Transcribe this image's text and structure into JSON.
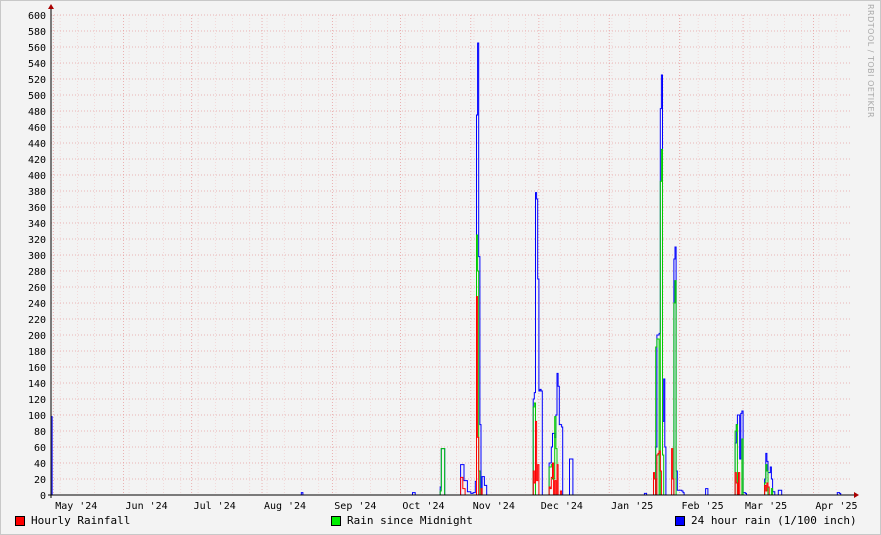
{
  "watermark": "RRDTOOL / TOBI OETIKER",
  "chart_data": {
    "type": "line",
    "ylim": [
      0,
      600
    ],
    "yticks": [
      0,
      20,
      40,
      60,
      80,
      100,
      120,
      140,
      160,
      180,
      200,
      220,
      240,
      260,
      280,
      300,
      320,
      340,
      360,
      380,
      400,
      420,
      440,
      460,
      480,
      500,
      520,
      540,
      560,
      580,
      600
    ],
    "x_tick_labels": [
      "May '24",
      "Jun '24",
      "Jul '24",
      "Aug '24",
      "Sep '24",
      "Oct '24",
      "Nov '24",
      "Dec '24",
      "Jan '25",
      "Feb '25",
      "Mar '25",
      "Apr '25"
    ],
    "x_tick_days": [
      0,
      31,
      61,
      92,
      123,
      153,
      184,
      214,
      245,
      276,
      304,
      335
    ],
    "xlim_days": [
      -1,
      352
    ],
    "grid": true,
    "legend_position": "bottom",
    "colors": {
      "hourly": "#ff0000",
      "midnight": "#00cc00",
      "day24": "#0000ff",
      "axis": "#aa0000",
      "grid": "#e8a0a0"
    },
    "series": [
      {
        "key": "day24",
        "name": "24 hour rain (1/100 inch)",
        "points": [
          [
            -1,
            98
          ],
          [
            -0.5,
            0
          ],
          [
            109,
            0
          ],
          [
            109.3,
            3
          ],
          [
            110,
            0
          ],
          [
            158,
            0
          ],
          [
            158.3,
            3
          ],
          [
            159.5,
            0
          ],
          [
            170,
            0
          ],
          [
            170.5,
            10
          ],
          [
            171,
            58
          ],
          [
            172.5,
            0
          ],
          [
            179,
            0
          ],
          [
            179.5,
            38
          ],
          [
            181,
            18
          ],
          [
            182.5,
            4
          ],
          [
            184,
            2
          ],
          [
            185,
            3
          ],
          [
            186,
            17
          ],
          [
            186.5,
            475
          ],
          [
            187,
            565
          ],
          [
            187.5,
            298
          ],
          [
            188,
            88
          ],
          [
            188.5,
            2
          ],
          [
            189,
            23
          ],
          [
            190,
            12
          ],
          [
            191,
            0
          ],
          [
            211,
            0
          ],
          [
            211.5,
            120
          ],
          [
            212,
            128
          ],
          [
            212.5,
            378
          ],
          [
            213,
            370
          ],
          [
            213.5,
            270
          ],
          [
            214,
            130
          ],
          [
            214.5,
            132
          ],
          [
            215,
            130
          ],
          [
            215.5,
            0
          ],
          [
            218,
            0
          ],
          [
            218.5,
            40
          ],
          [
            219.5,
            60
          ],
          [
            220,
            77
          ],
          [
            221,
            72
          ],
          [
            221.5,
            100
          ],
          [
            222,
            152
          ],
          [
            222.5,
            136
          ],
          [
            223,
            88
          ],
          [
            224,
            85
          ],
          [
            224.5,
            0
          ],
          [
            227,
            0
          ],
          [
            227.5,
            45
          ],
          [
            229,
            0
          ],
          [
            260,
            0
          ],
          [
            260.5,
            2
          ],
          [
            261.5,
            0
          ],
          [
            265,
            0
          ],
          [
            265.5,
            60
          ],
          [
            266,
            200
          ],
          [
            267,
            202
          ],
          [
            267.5,
            483
          ],
          [
            268,
            525
          ],
          [
            268.5,
            92
          ],
          [
            269,
            145
          ],
          [
            269.5,
            60
          ],
          [
            270,
            0
          ],
          [
            273,
            0
          ],
          [
            273.5,
            295
          ],
          [
            274,
            310
          ],
          [
            274.5,
            30
          ],
          [
            275,
            6
          ],
          [
            277,
            5
          ],
          [
            277.5,
            3
          ],
          [
            278,
            0
          ],
          [
            287,
            0
          ],
          [
            287.5,
            8
          ],
          [
            288.5,
            0
          ],
          [
            300,
            0
          ],
          [
            300.5,
            65
          ],
          [
            301,
            88
          ],
          [
            301.5,
            100
          ],
          [
            302.5,
            45
          ],
          [
            303,
            102
          ],
          [
            303.5,
            105
          ],
          [
            304,
            3
          ],
          [
            305,
            2
          ],
          [
            305.5,
            0
          ],
          [
            313,
            0
          ],
          [
            313.5,
            20
          ],
          [
            314,
            52
          ],
          [
            314.5,
            42
          ],
          [
            315,
            28
          ],
          [
            316,
            35
          ],
          [
            316.5,
            20
          ],
          [
            317,
            4
          ],
          [
            318,
            0
          ],
          [
            319,
            0
          ],
          [
            319.5,
            6
          ],
          [
            321,
            0
          ],
          [
            345,
            0
          ],
          [
            345.5,
            3
          ],
          [
            346.5,
            2
          ],
          [
            347,
            0
          ],
          [
            352,
            0
          ]
        ]
      },
      {
        "key": "midnight",
        "name": "Rain since Midnight",
        "points": [
          [
            -1,
            0
          ],
          [
            170,
            0
          ],
          [
            170.5,
            5
          ],
          [
            171,
            58
          ],
          [
            172.5,
            0
          ],
          [
            186,
            0
          ],
          [
            186.5,
            325
          ],
          [
            187,
            280
          ],
          [
            187.5,
            30
          ],
          [
            188,
            0
          ],
          [
            211,
            0
          ],
          [
            211.5,
            110
          ],
          [
            212,
            115
          ],
          [
            212.5,
            0
          ],
          [
            218,
            0
          ],
          [
            218.5,
            35
          ],
          [
            219.5,
            38
          ],
          [
            220,
            20
          ],
          [
            221,
            98
          ],
          [
            221.5,
            58
          ],
          [
            222,
            0
          ],
          [
            265,
            0
          ],
          [
            265.5,
            185
          ],
          [
            266,
            195
          ],
          [
            267,
            0
          ],
          [
            267.5,
            392
          ],
          [
            268,
            432
          ],
          [
            268.5,
            50
          ],
          [
            269,
            0
          ],
          [
            273,
            0
          ],
          [
            273.5,
            240
          ],
          [
            274,
            268
          ],
          [
            274.5,
            0
          ],
          [
            300,
            0
          ],
          [
            300.5,
            80
          ],
          [
            301,
            88
          ],
          [
            301.5,
            0
          ],
          [
            303,
            0
          ],
          [
            303.5,
            70
          ],
          [
            304,
            0
          ],
          [
            313,
            0
          ],
          [
            313.5,
            15
          ],
          [
            314,
            38
          ],
          [
            314.5,
            30
          ],
          [
            315,
            0
          ],
          [
            316,
            0
          ],
          [
            316.5,
            8
          ],
          [
            317,
            0
          ],
          [
            352,
            0
          ]
        ]
      },
      {
        "key": "hourly",
        "name": "Hourly Rainfall",
        "points": [
          [
            -1,
            0
          ],
          [
            179,
            0
          ],
          [
            179.5,
            22
          ],
          [
            180.5,
            8
          ],
          [
            181.5,
            0
          ],
          [
            186,
            0
          ],
          [
            186.5,
            248
          ],
          [
            187,
            72
          ],
          [
            187.5,
            0
          ],
          [
            188,
            0
          ],
          [
            188.5,
            8
          ],
          [
            189,
            0
          ],
          [
            211,
            0
          ],
          [
            211.5,
            30
          ],
          [
            212,
            15
          ],
          [
            212.5,
            92
          ],
          [
            213,
            18
          ],
          [
            213.5,
            38
          ],
          [
            214,
            0
          ],
          [
            218,
            0
          ],
          [
            218.5,
            10
          ],
          [
            219,
            8
          ],
          [
            219.5,
            22
          ],
          [
            220,
            40
          ],
          [
            220.5,
            0
          ],
          [
            221,
            18
          ],
          [
            221.5,
            0
          ],
          [
            222,
            38
          ],
          [
            222.5,
            0
          ],
          [
            223,
            0
          ],
          [
            223.5,
            5
          ],
          [
            224,
            0
          ],
          [
            264,
            0
          ],
          [
            264.5,
            28
          ],
          [
            265,
            20
          ],
          [
            265.5,
            0
          ],
          [
            266,
            50
          ],
          [
            266.5,
            52
          ],
          [
            267,
            55
          ],
          [
            267.5,
            30
          ],
          [
            268,
            0
          ],
          [
            272,
            0
          ],
          [
            272.5,
            58
          ],
          [
            273,
            20
          ],
          [
            273.5,
            0
          ],
          [
            300,
            0
          ],
          [
            300.5,
            28
          ],
          [
            301,
            15
          ],
          [
            301.5,
            0
          ],
          [
            302,
            28
          ],
          [
            302.5,
            0
          ],
          [
            313,
            0
          ],
          [
            313.5,
            12
          ],
          [
            314,
            5
          ],
          [
            314.5,
            15
          ],
          [
            315,
            10
          ],
          [
            315.5,
            0
          ],
          [
            352,
            0
          ]
        ]
      }
    ]
  }
}
